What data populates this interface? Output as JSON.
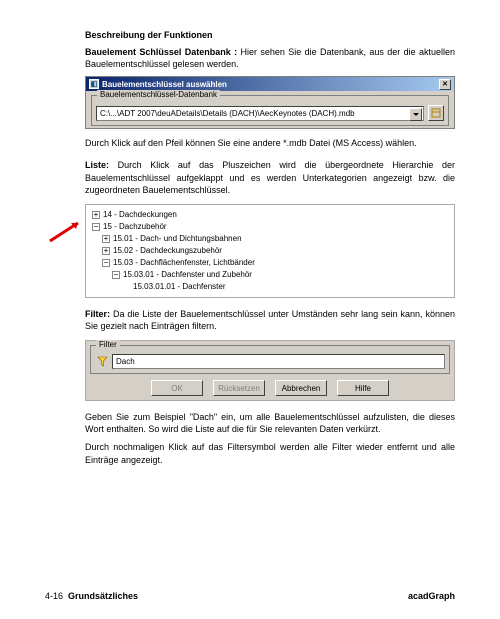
{
  "heading": "Beschreibung der Funktionen",
  "p1_bold": "Bauelement Schlüssel Datenbank :",
  "p1_rest": " Hier sehen Sie die Datenbank, aus der die aktuellen Bauelementschlüssel gelesen werden.",
  "dialog": {
    "title": "Bauelementschlüssel auswählen",
    "group_label": "Bauelementschlüssel-Datenbank",
    "path": "C:\\...\\ADT 2007\\deuADetails\\Details (DACH)\\AecKeynotes (DACH).mdb"
  },
  "p2": "Durch Klick auf den Pfeil können Sie eine andere *.mdb Datei (MS Access) wählen.",
  "p3_bold": "Liste:",
  "p3_rest": " Durch Klick auf das Pluszeichen wird die übergeordnete Hierarchie der Bauelementschlüssel aufgeklappt und es werden Unterkategorien angezeigt bzw. die zugeordneten Bauelementschlüssel.",
  "tree": [
    {
      "level": 1,
      "exp": "+",
      "label": "14 - Dachdeckungen"
    },
    {
      "level": 1,
      "exp": "−",
      "label": "15 - Dachzubehör"
    },
    {
      "level": 2,
      "exp": "+",
      "label": "15.01 - Dach- und Dichtungsbahnen"
    },
    {
      "level": 2,
      "exp": "+",
      "label": "15.02 - Dachdeckungszubehör"
    },
    {
      "level": 2,
      "exp": "−",
      "label": "15.03 - Dachflächenfenster, Lichtbänder"
    },
    {
      "level": 3,
      "exp": "−",
      "label": "15.03.01 - Dachfenster und Zubehör"
    },
    {
      "level": 4,
      "exp": "",
      "label": "15.03.01.01 - Dachfenster"
    }
  ],
  "p4_bold": "Filter:",
  "p4_rest": " Da die Liste der Bauelementschlüssel unter Umständen sehr lang sein kann, können Sie gezielt nach Einträgen filtern.",
  "filter": {
    "group_label": "Filter",
    "value": "Dach",
    "buttons": {
      "ok": "OK",
      "reset": "Rücksetzen",
      "cancel": "Abbrechen",
      "help": "Hilfe"
    }
  },
  "p5": "Geben Sie zum Beispiel \"Dach\" ein, um alle Bauelementschlüssel aufzulisten, die dieses Wort enthalten. So wird die Liste auf die für Sie relevanten Daten verkürzt.",
  "p6": "Durch nochmaligen Klick auf das Filtersymbol werden alle Filter wieder entfernt und alle Einträge angezeigt.",
  "footer": {
    "left_page": "4-16",
    "left_section": "Grundsätzliches",
    "right": "acadGraph"
  }
}
